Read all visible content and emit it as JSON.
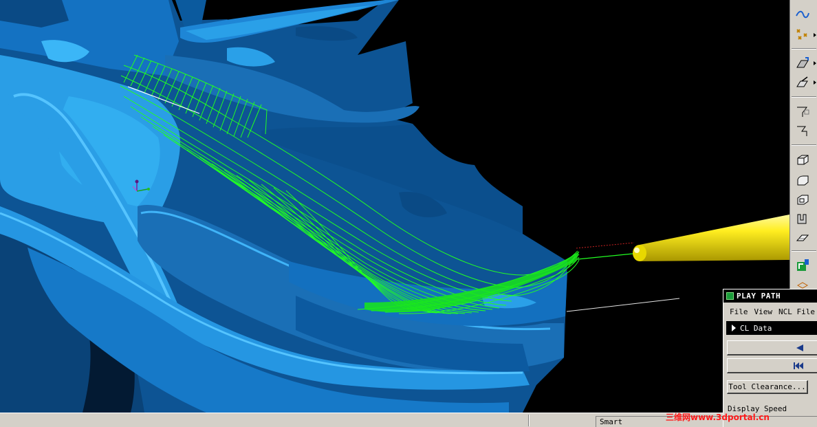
{
  "play_path": {
    "title": "PLAY PATH",
    "menu": [
      "File",
      "View",
      "NCL File"
    ],
    "selected_item": "CL Data",
    "tool_clearance_label": "Tool Clearance...",
    "display_speed_label": "Display Speed"
  },
  "status_bar": {
    "mode": "Smart"
  },
  "watermark": "三维网www.3dportal.cn",
  "toolbar_icons": [
    "curve-wave-icon",
    "points-cross-icon",
    "surface-plane-icon",
    "surface-sweep-icon",
    "polyline-icon",
    "polyline-offset-icon",
    "solid-box-icon",
    "solid-round-box-icon",
    "solid-shell-icon",
    "solid-extrude-icon",
    "solid-slice-icon",
    "toolpath-icon",
    "mesh-icon"
  ],
  "colors": {
    "part_dark": "#0a4c86",
    "part_mid": "#1a6fb6",
    "part_light": "#2aa0e8",
    "toolpath": "#22ff22",
    "tool": "#ffee00",
    "panel_bg": "#d4d0c8"
  }
}
